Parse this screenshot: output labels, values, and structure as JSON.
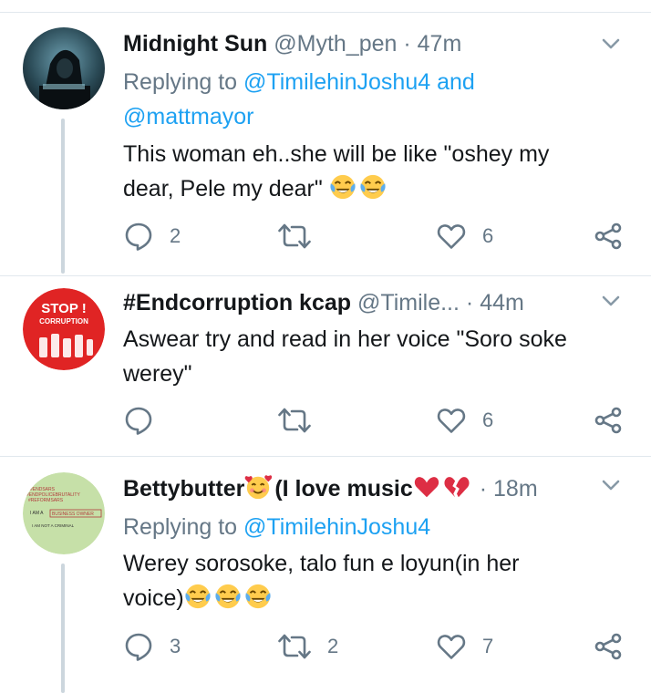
{
  "tweets": [
    {
      "name": "Midnight Sun",
      "handle": "@Myth_pen",
      "dot": "·",
      "time": "47m",
      "replying_prefix": "Replying to",
      "replying_users": [
        "@TimilehinJoshu4",
        "@mattmayor"
      ],
      "replying_and": "and",
      "text_line1": "This woman eh..she will be like \"oshey my",
      "text_line2": "dear, Pele my dear\"",
      "emojis": [
        "face-with-tears-of-joy",
        "face-with-tears-of-joy"
      ],
      "reply_count": "2",
      "retweet_count": "",
      "like_count": "6"
    },
    {
      "name": "#Endcorruption kcap",
      "handle": "@Timile...",
      "dot": "·",
      "time": "44m",
      "text_line1": "Aswear try and read in her voice \"Soro soke",
      "text_line2": "werey\"",
      "avatar_text": [
        "STOP !",
        "CORRUPTION"
      ],
      "reply_count": "",
      "retweet_count": "",
      "like_count": "6"
    },
    {
      "name": "Bettybutter",
      "name_suffix": "(I love music",
      "dot": "·",
      "time": "18m",
      "replying_prefix": "Replying to",
      "replying_users": [
        "@TimilehinJoshu4"
      ],
      "text_line1": "Werey sorosoke, talo fun e loyun(in her",
      "text_line2": "voice)",
      "emojis": [
        "face-with-tears-of-joy",
        "face-with-tears-of-joy",
        "face-with-tears-of-joy"
      ],
      "avatar_text": [
        "#ENDSARS",
        "#ENDPOLICEBRUTALITY",
        "#REFORMSARS",
        "I AM A",
        "BUSINESS OWNER",
        "I AM NOT A CRIMINAL"
      ],
      "reply_count": "3",
      "retweet_count": "2",
      "like_count": "7"
    }
  ],
  "colors": {
    "link": "#1da1f2",
    "muted": "#657786",
    "text": "#14171a",
    "divider": "#e1e8ed",
    "thread_line": "#ccd6dd"
  },
  "icons": [
    "chevron-down-icon",
    "reply-icon",
    "retweet-icon",
    "like-icon",
    "share-icon",
    "face-with-tears-of-joy",
    "smiling-face-with-hearts",
    "red-heart",
    "broken-heart"
  ]
}
